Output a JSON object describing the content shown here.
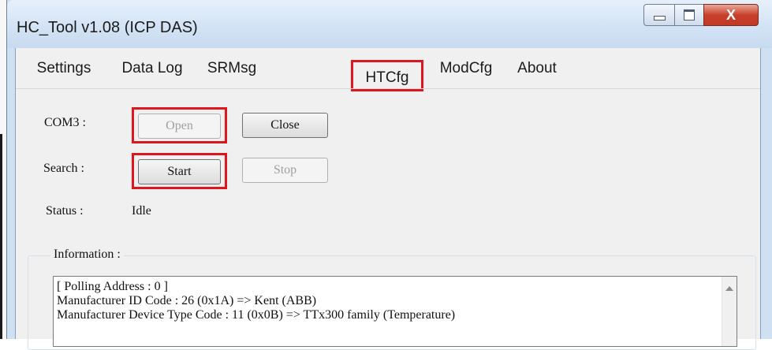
{
  "window": {
    "title": "HC_Tool v1.08  (ICP DAS)",
    "close_glyph": "X"
  },
  "menu": {
    "items": [
      "Settings",
      "Data Log",
      "SRMsg",
      "HTCfg",
      "ModCfg",
      "About"
    ],
    "highlighted": "HTCfg"
  },
  "com": {
    "label": "COM3 :",
    "open_label": "Open",
    "close_label": "Close"
  },
  "search": {
    "label": "Search :",
    "start_label": "Start",
    "stop_label": "Stop"
  },
  "status": {
    "label": "Status :",
    "value": "Idle"
  },
  "information": {
    "title": "Information :",
    "lines": [
      "[ Polling Address : 0 ]",
      "Manufacturer ID Code : 26 (0x1A) => Kent (ABB)",
      "Manufacturer Device Type Code : 11 (0x0B) => TTx300 family (Temperature)"
    ]
  },
  "colors": {
    "highlight": "#e0161e",
    "window_frame": "#cfe0f3",
    "close_button": "#c9412c"
  }
}
